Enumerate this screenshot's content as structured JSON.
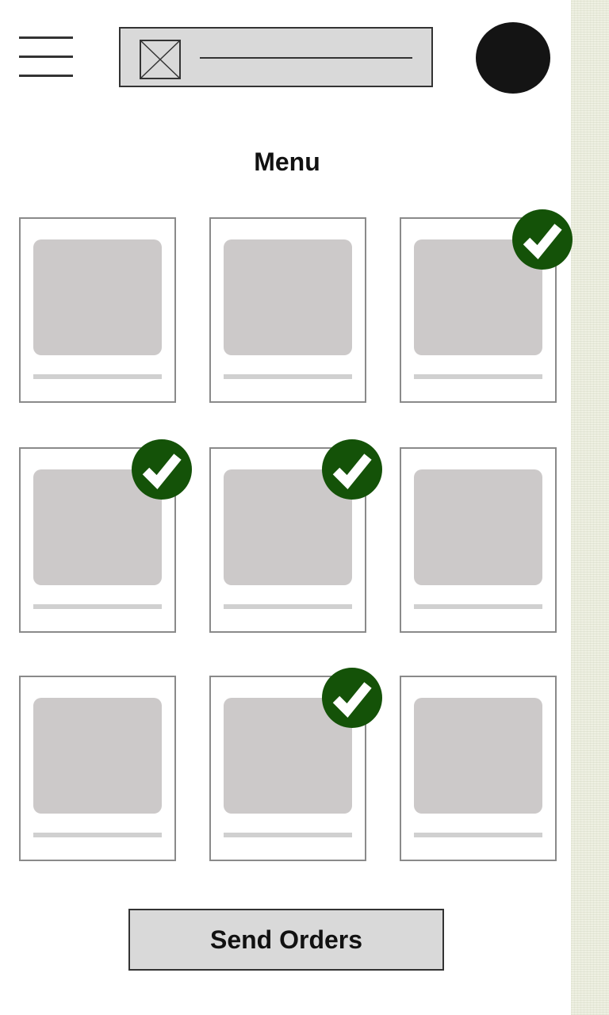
{
  "header": {
    "menu_icon": "hamburger-menu-icon",
    "logo_icon": "image-placeholder-icon",
    "avatar_icon": "user-avatar"
  },
  "page": {
    "title": "Menu"
  },
  "menu_items": [
    {
      "selected": false
    },
    {
      "selected": false
    },
    {
      "selected": true
    },
    {
      "selected": true
    },
    {
      "selected": true
    },
    {
      "selected": false
    },
    {
      "selected": false
    },
    {
      "selected": true
    },
    {
      "selected": false
    }
  ],
  "actions": {
    "send_label": "Send Orders"
  },
  "colors": {
    "check_badge": "#145208",
    "thumbnail": "#ccc9c9",
    "button_bg": "#d9d9d9",
    "avatar": "#141414"
  }
}
